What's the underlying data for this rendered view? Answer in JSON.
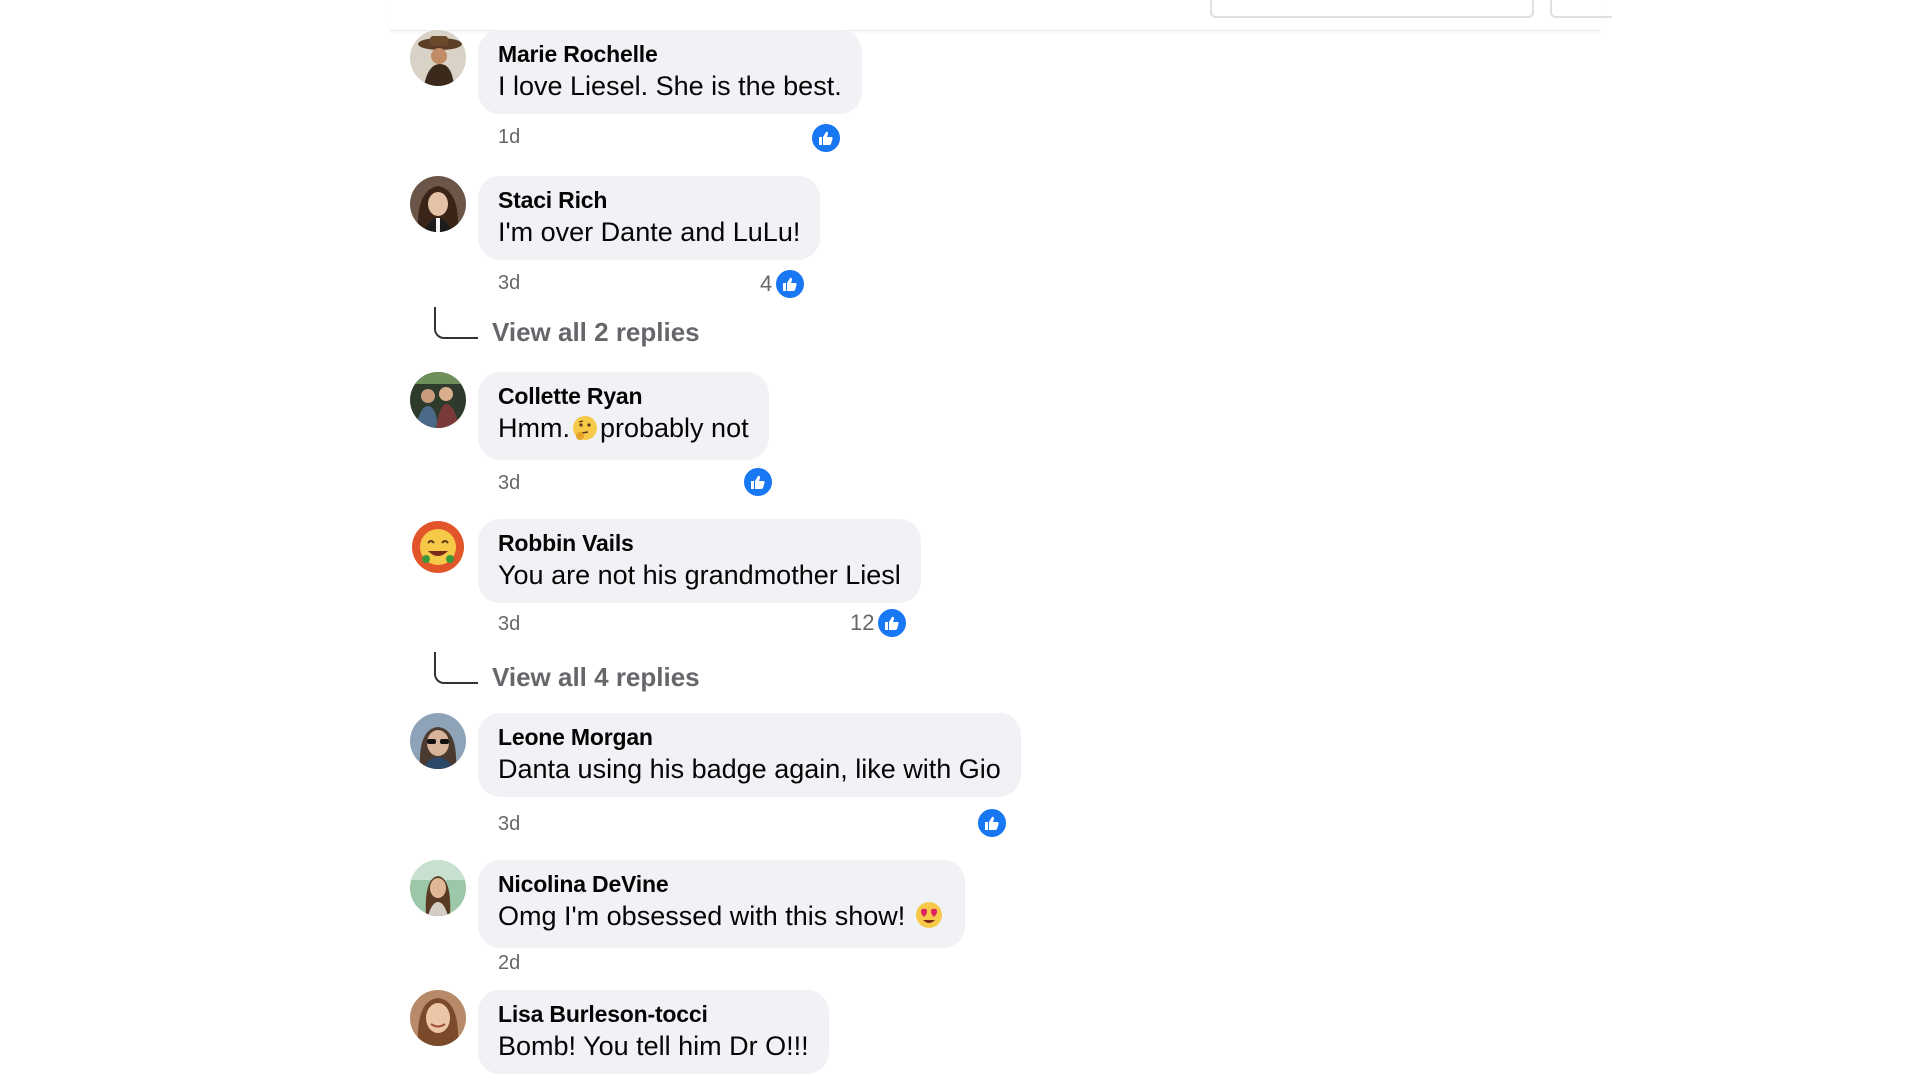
{
  "comments": [
    {
      "author": "Marie Rochelle",
      "text": "I love Liesel. She is the best.",
      "time": "1d",
      "likes": "",
      "avatar": "avatar-cowboy-hat"
    },
    {
      "author": "Staci Rich",
      "text": "I'm over Dante and LuLu!",
      "time": "3d",
      "likes": "4",
      "avatar": "avatar-woman-dark-hair"
    },
    {
      "author": "Collette Ryan",
      "text_before": "Hmm.",
      "text_after": "probably not",
      "time": "3d",
      "likes": "",
      "avatar": "avatar-group-photo"
    },
    {
      "author": "Robbin Vails",
      "text": "You are not his grandmother Liesl",
      "time": "3d",
      "likes": "12",
      "avatar": "avatar-emoji-face"
    },
    {
      "author": "Leone Morgan",
      "text": "Danta using his badge again, like with Gio",
      "time": "3d",
      "likes": "",
      "avatar": "avatar-woman-sunglasses"
    },
    {
      "author": "Nicolina DeVine",
      "text": "Omg I'm obsessed with this show!",
      "time": "2d",
      "likes": "",
      "avatar": "avatar-woman-outdoors"
    },
    {
      "author": "Lisa Burleson-tocci",
      "text": "Bomb! You tell him Dr O!!!",
      "time": "",
      "likes": "",
      "avatar": "avatar-woman-smiling"
    }
  ],
  "replies": [
    {
      "label": "View all 2 replies"
    },
    {
      "label": "View all 4 replies"
    }
  ],
  "colors": {
    "bubble": "#f0f2f5",
    "like_blue": "#1877f2",
    "meta_gray": "#65676b"
  },
  "icons": {
    "like": "thumbs-up-icon",
    "thinking_emoji": "thinking-face-emoji",
    "heart_eyes_emoji": "heart-eyes-emoji"
  }
}
